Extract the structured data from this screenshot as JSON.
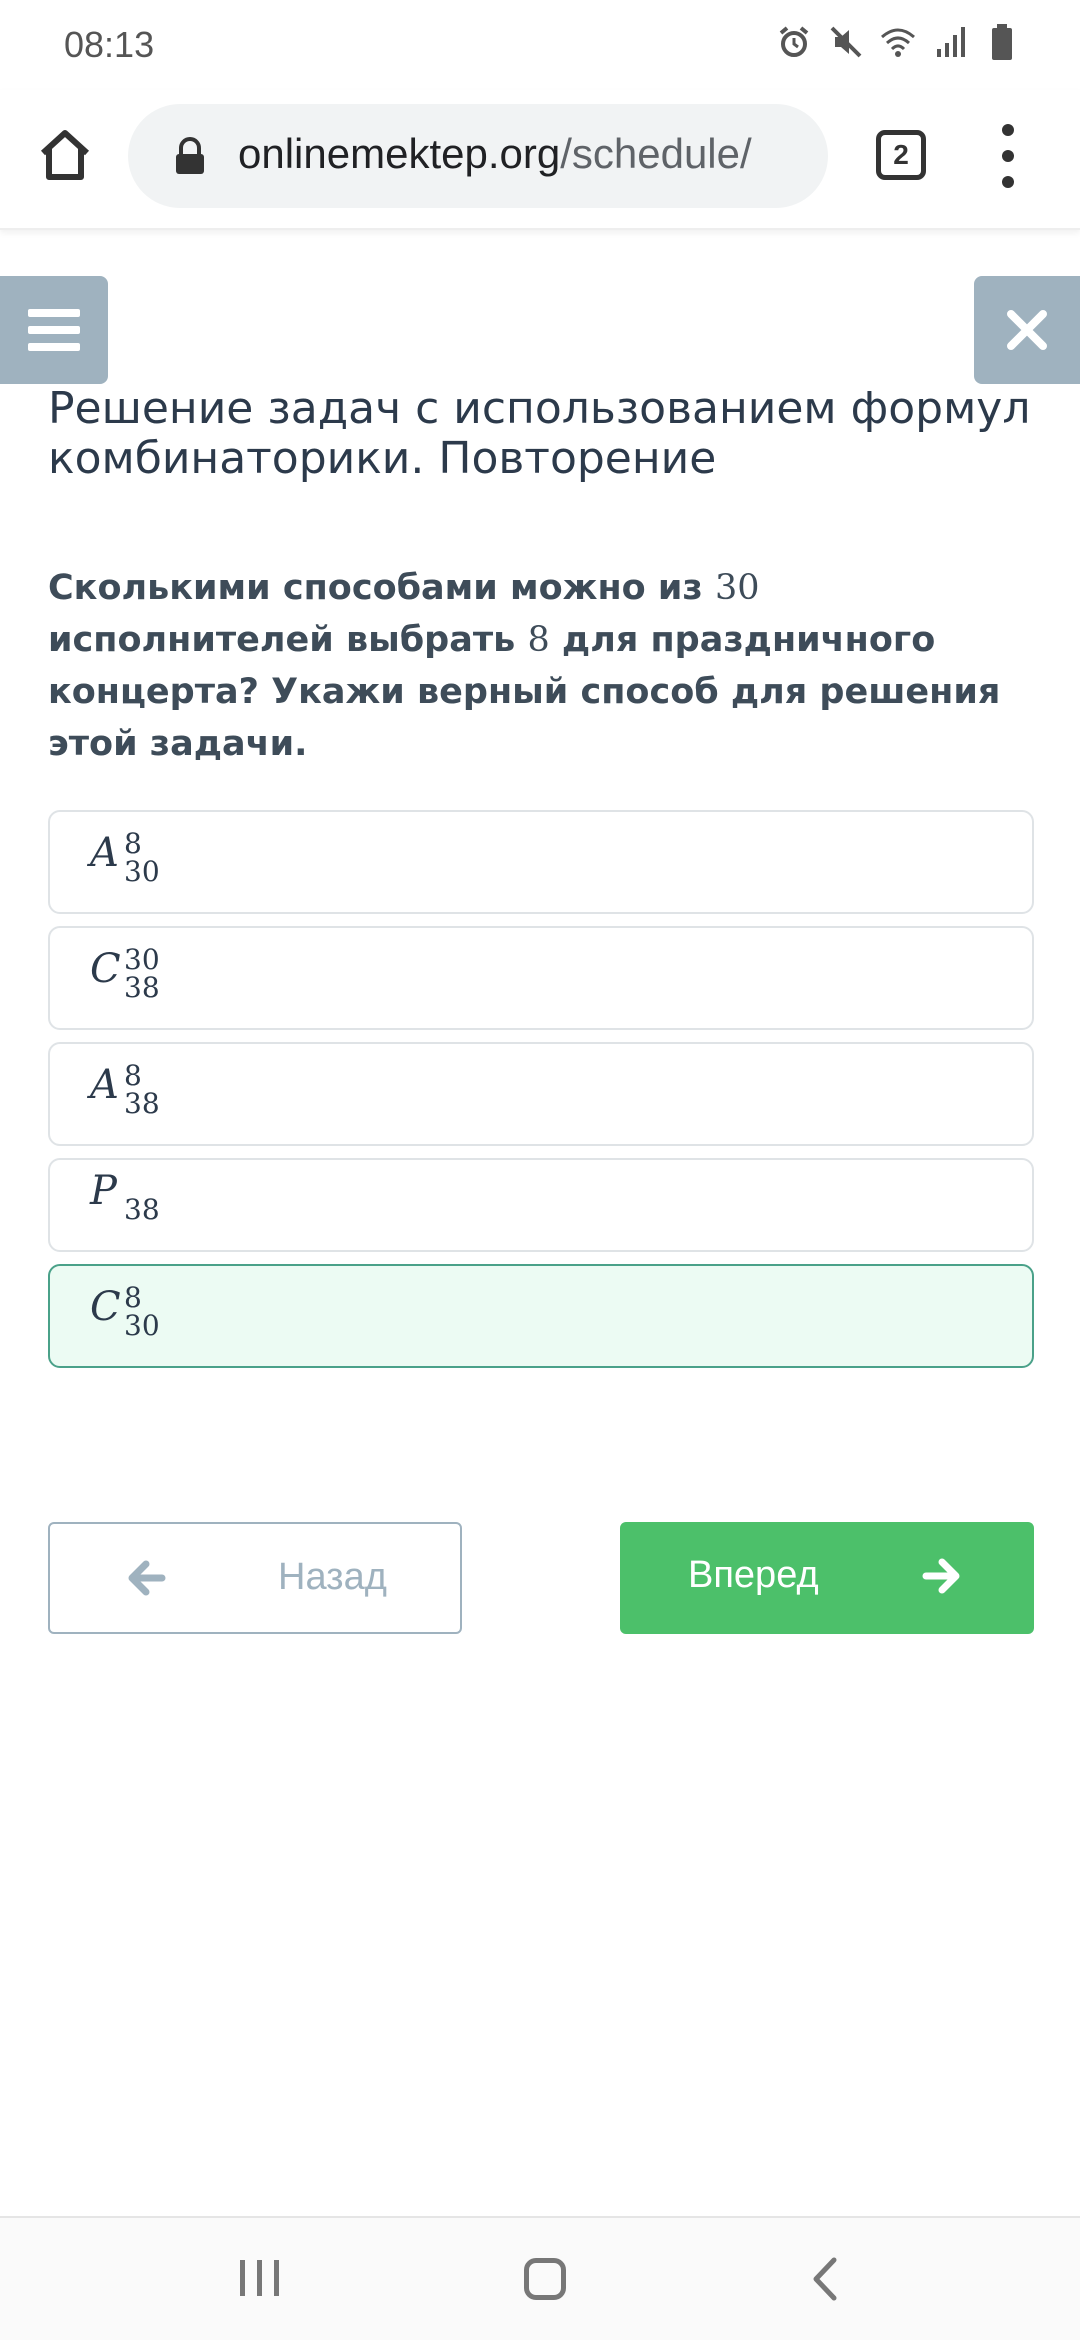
{
  "status_bar": {
    "time": "08:13",
    "icons": [
      "alarm-icon",
      "mute-icon",
      "wifi-icon",
      "signal-icon",
      "battery-icon"
    ]
  },
  "browser": {
    "url_domain": "onlinemektep.org",
    "url_path": "/schedule/",
    "tab_count": "2"
  },
  "lesson": {
    "title": "Решение задач с использованием формул комбинаторики. Повторение"
  },
  "question": {
    "part1": "Сколькими способами можно из ",
    "num1": "30",
    "part2": " исполнителей выбрать ",
    "num2": "8",
    "part3": " для праздничного концерта? Укажи верный способ для решения этой задачи."
  },
  "options": [
    {
      "base": "A",
      "sup": "8",
      "sub": "30",
      "selected": false
    },
    {
      "base": "C",
      "sup": "30",
      "sub": "38",
      "selected": false
    },
    {
      "base": "A",
      "sup": "8",
      "sub": "38",
      "selected": false
    },
    {
      "base": "P",
      "sup": "",
      "sub": "38",
      "selected": false
    },
    {
      "base": "C",
      "sup": "8",
      "sub": "30",
      "selected": true
    }
  ],
  "navigation": {
    "back_label": "Назад",
    "next_label": "Вперед"
  },
  "colors": {
    "accent_green": "#4cc06a",
    "selected_border": "#4aa189",
    "selected_bg": "#ecfbf3",
    "muted_button": "#9fb2bf"
  }
}
